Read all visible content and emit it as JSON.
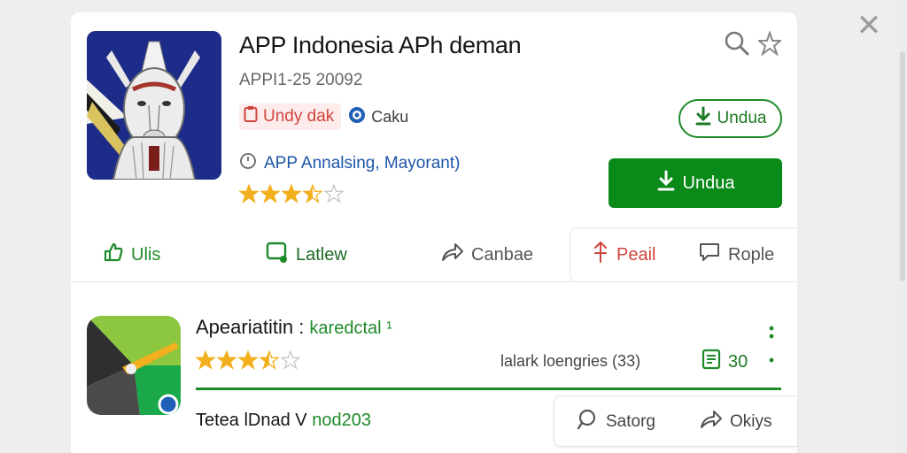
{
  "window": {
    "close_glyph": "✕"
  },
  "app": {
    "title": "APP Indonesia APh deman",
    "id": "APPI1-25 20092",
    "badge_red": "Undy dak",
    "badge_blue": "Caku",
    "developer": "APP Annalsing, Mayorant)",
    "rating": 3.5,
    "install_outline_label": "Undua",
    "install_label": "Undua"
  },
  "actions": [
    {
      "label": "Ulis",
      "icon": "thumbs-up-icon",
      "color": "#1e8a29"
    },
    {
      "label": "Latlew",
      "icon": "chat-bubble-icon",
      "color": "#1e8a29"
    },
    {
      "label": "Canbae",
      "icon": "share-arrow-icon",
      "color": "#555555"
    },
    {
      "label": "Peail",
      "icon": "lightbulb-icon",
      "color": "#d0443d"
    },
    {
      "label": "Rople",
      "icon": "comment-icon",
      "color": "#555555"
    }
  ],
  "second": {
    "title": "Apeariatitin",
    "title_sep": " : ",
    "subtitle": "karedctal ¹",
    "rating": 3.5,
    "meta_label": "lalark loengries (33)",
    "count": "30",
    "bottom_label": "Tetea lDnad V ",
    "bottom_label_green": "nod203",
    "bottom_action_1": "Satorg",
    "bottom_action_2": "Okiys"
  },
  "colors": {
    "accent": "#1e8a29",
    "install_bg": "#0a8a18",
    "star": "#f2b01e",
    "star_empty": "#c8c8c8"
  }
}
